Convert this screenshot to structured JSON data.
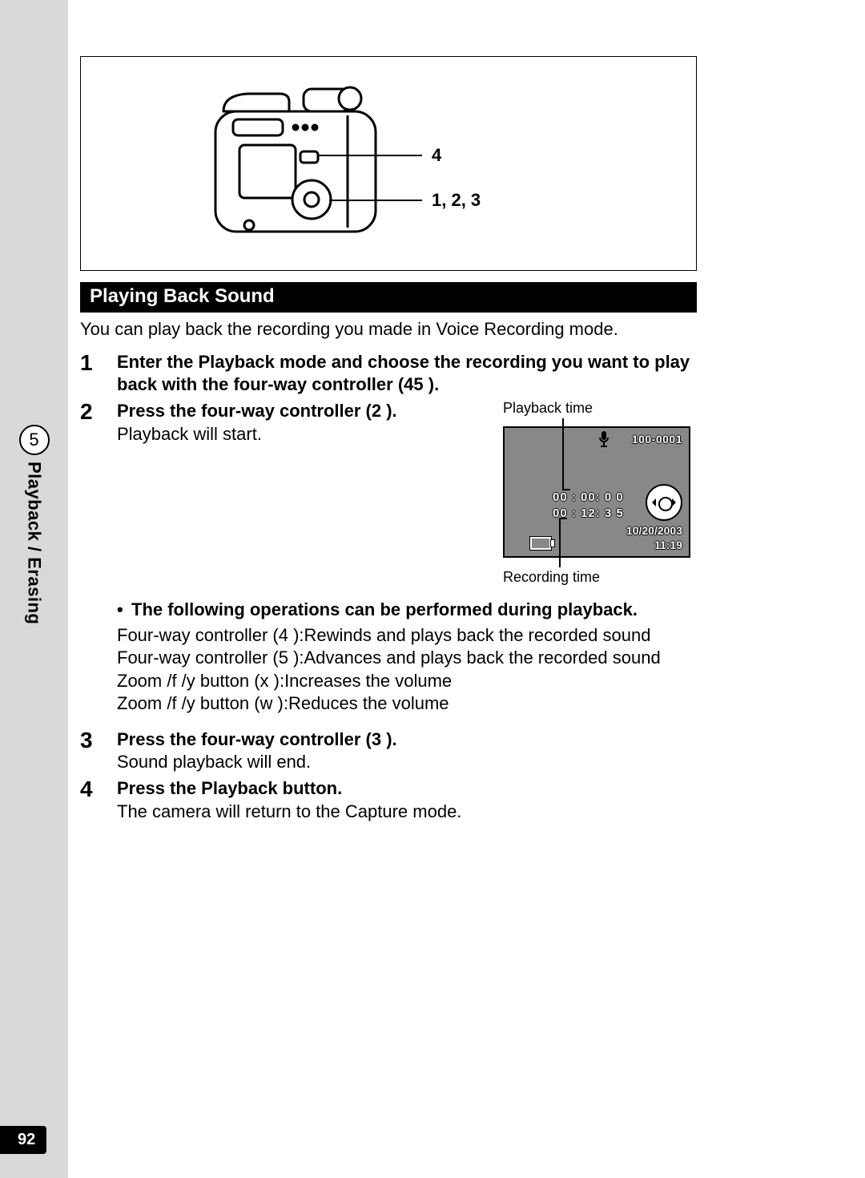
{
  "side": {
    "chapter_num": "5",
    "chapter_label": "Playback / Erasing"
  },
  "page_number": "92",
  "illustration": {
    "callout_top": "4",
    "callout_bottom": "1, 2, 3"
  },
  "section_title": "Playing Back Sound",
  "intro": "You can play back the recording you made in Voice Recording mode.",
  "steps": {
    "s1": {
      "num": "1",
      "title": "Enter the Playback mode and choose the recording you want to play back with the four-way controller (45   )."
    },
    "s2": {
      "num": "2",
      "title": "Press the four-way controller (2   ).",
      "sub": "Playback will start."
    },
    "s3": {
      "num": "3",
      "title": "Press the four-way controller (3   ).",
      "sub": "Sound playback will end."
    },
    "s4": {
      "num": "4",
      "title": "Press the Playback button.",
      "sub": "The camera will return to the Capture mode."
    }
  },
  "screen": {
    "caption_top": "Playback time",
    "caption_bottom": "Recording time",
    "file_number": "100-0001",
    "time_elapsed": "00 : 00: 0 0",
    "time_total": "00 : 12: 3 5",
    "date": "10/20/2003",
    "clock": "11:19"
  },
  "bullet": {
    "heading": "The following operations can be performed during playback.",
    "lines": [
      "Four-way controller (4  ):Rewinds and plays back the recorded sound",
      "Four-way controller (5  ):Advances and plays back the recorded sound",
      "Zoom /f   /y   button (x  ):Increases the volume",
      "Zoom /f   /y   button (w  ):Reduces the volume"
    ]
  }
}
